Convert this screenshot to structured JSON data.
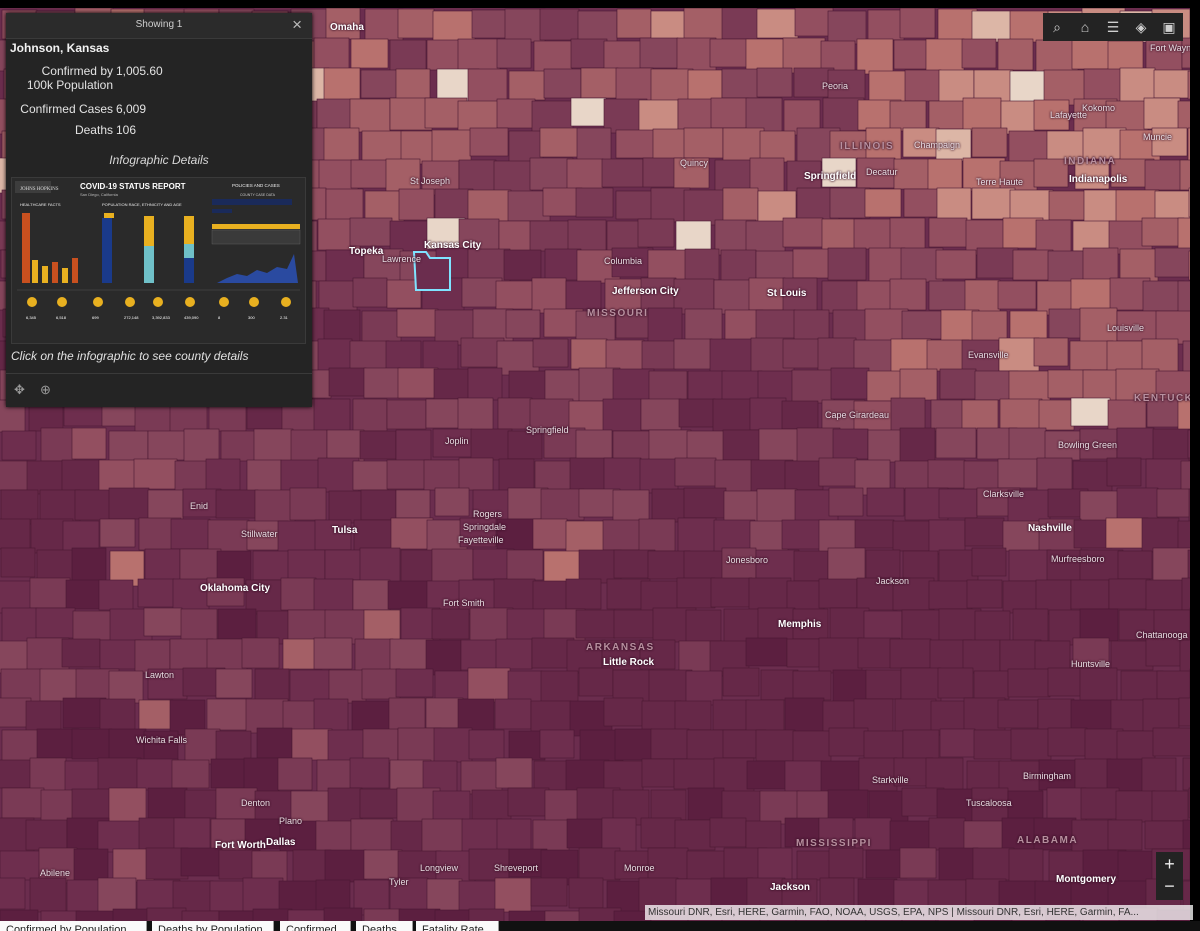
{
  "popup": {
    "header": "Showing 1",
    "close_icon": "close-icon",
    "county": "Johnson, Kansas",
    "attributes": [
      {
        "label": "Confirmed by",
        "label2": "100k Population",
        "value": "1,005.60"
      },
      {
        "label": "Confirmed Cases",
        "value": "6,009"
      },
      {
        "label": "Deaths",
        "value": "106"
      }
    ],
    "infographic_title": "Infographic Details",
    "infographic": {
      "logo": "JOHNS HOPKINS",
      "title": "COVID-19 STATUS REPORT",
      "subtitle": "San Diego, California",
      "policies": "POLICIES AND CASES",
      "healthcare": "HEALTHCARE FACTS",
      "population": "POPULATION RACE, ETHNICITY AND AGE",
      "case_data": "COUNTY CASE DATA",
      "stats": [
        "6,345",
        "6,518",
        "699",
        "272,148",
        "3,392,833",
        "439,090",
        "8",
        "300",
        "2.31"
      ]
    },
    "hint": "Click on the infographic to see county details",
    "footer_icons": [
      "pan-icon",
      "zoom-to-icon"
    ]
  },
  "toolbar": {
    "icons": [
      "search-icon",
      "home-icon",
      "legend-icon",
      "layers-icon",
      "qr-code-icon"
    ]
  },
  "zoom": {
    "in": "+",
    "out": "−"
  },
  "attribution": "Missouri DNR, Esri, HERE, Garmin, FAO, NOAA, USGS, EPA, NPS | Missouri DNR, Esri, HERE, Garmin, FA...",
  "tabs": [
    "Confirmed by Population",
    "Deaths by Population",
    "Confirmed",
    "Deaths",
    "Fatality Rate"
  ],
  "places": [
    {
      "name": "Omaha",
      "big": true
    },
    {
      "name": "Peoria"
    },
    {
      "name": "Fort Wayne"
    },
    {
      "name": "Kokomo"
    },
    {
      "name": "Lafayette"
    },
    {
      "name": "Muncie"
    },
    {
      "name": "ILLINOIS",
      "state": true
    },
    {
      "name": "Champaign"
    },
    {
      "name": "INDIANA",
      "state": true
    },
    {
      "name": "Quincy"
    },
    {
      "name": "Springfield",
      "big": true
    },
    {
      "name": "Decatur"
    },
    {
      "name": "Indianapolis",
      "big": true
    },
    {
      "name": "St Joseph"
    },
    {
      "name": "Terre Haute"
    },
    {
      "name": "Kansas City",
      "big": true
    },
    {
      "name": "Topeka",
      "big": true
    },
    {
      "name": "Lawrence"
    },
    {
      "name": "Columbia"
    },
    {
      "name": "Jefferson City",
      "big": true
    },
    {
      "name": "MISSOURI",
      "state": true
    },
    {
      "name": "St Louis",
      "big": true
    },
    {
      "name": "Louisville"
    },
    {
      "name": "Evansville"
    },
    {
      "name": "Cape Girardeau"
    },
    {
      "name": "Joplin"
    },
    {
      "name": "Springfield"
    },
    {
      "name": "KENTUCKY",
      "state": true
    },
    {
      "name": "Bowling Green"
    },
    {
      "name": "Enid"
    },
    {
      "name": "Rogers"
    },
    {
      "name": "Springdale"
    },
    {
      "name": "Fayetteville"
    },
    {
      "name": "Clarksville"
    },
    {
      "name": "Tulsa",
      "big": true
    },
    {
      "name": "Stillwater"
    },
    {
      "name": "Nashville",
      "big": true
    },
    {
      "name": "Jonesboro"
    },
    {
      "name": "Murfreesboro"
    },
    {
      "name": "Oklahoma City",
      "big": true
    },
    {
      "name": "Jackson"
    },
    {
      "name": "Fort Smith"
    },
    {
      "name": "Memphis",
      "big": true
    },
    {
      "name": "ARKANSAS",
      "state": true
    },
    {
      "name": "Little Rock",
      "big": true
    },
    {
      "name": "Chattanooga"
    },
    {
      "name": "Lawton"
    },
    {
      "name": "Huntsville"
    },
    {
      "name": "Wichita Falls"
    },
    {
      "name": "Starkville"
    },
    {
      "name": "Birmingham"
    },
    {
      "name": "Denton"
    },
    {
      "name": "Tuscaloosa"
    },
    {
      "name": "Plano"
    },
    {
      "name": "Fort Worth",
      "big": true
    },
    {
      "name": "Dallas",
      "big": true
    },
    {
      "name": "MISSISSIPPI",
      "state": true
    },
    {
      "name": "ALABAMA",
      "state": true
    },
    {
      "name": "Abilene"
    },
    {
      "name": "Longview"
    },
    {
      "name": "Shreveport"
    },
    {
      "name": "Monroe"
    },
    {
      "name": "Tyler"
    },
    {
      "name": "Jackson",
      "big": true
    },
    {
      "name": "Montgomery",
      "big": true
    }
  ]
}
